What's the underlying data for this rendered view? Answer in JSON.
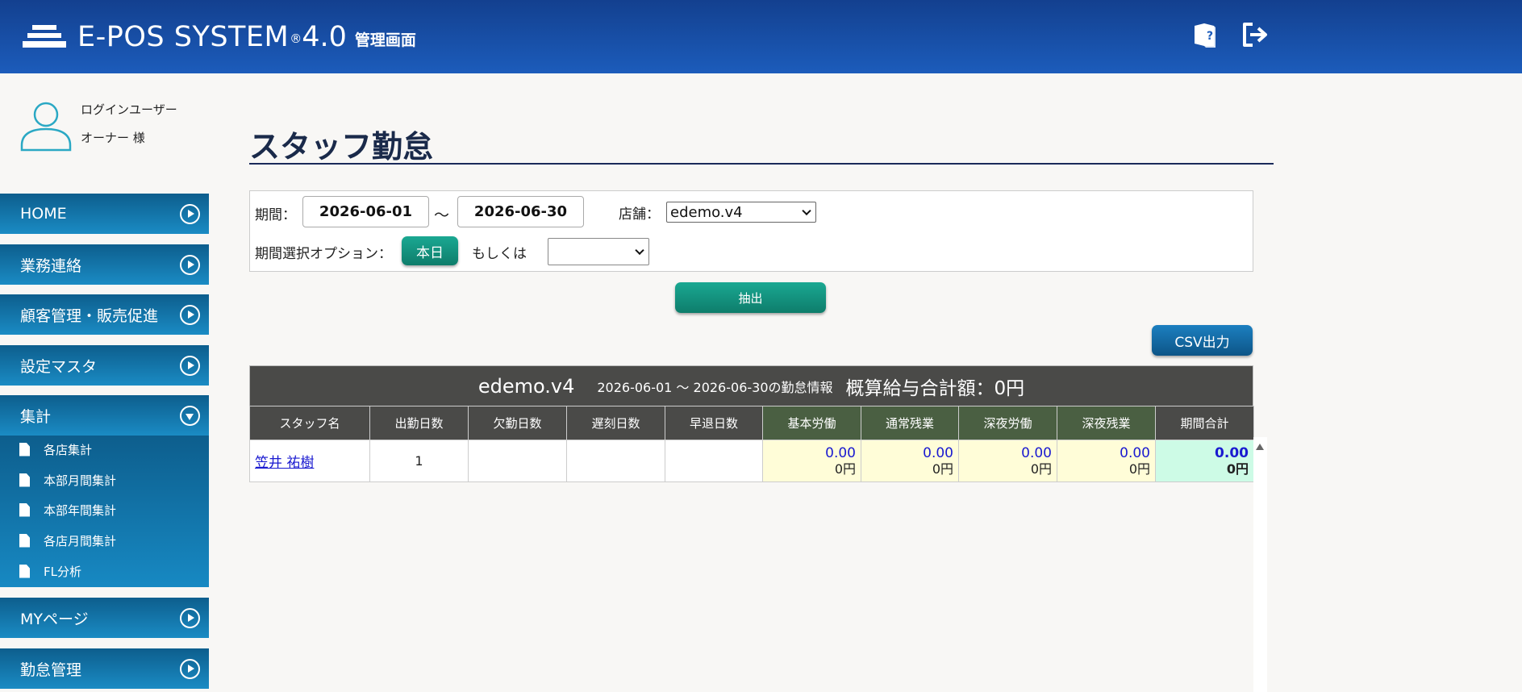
{
  "header": {
    "logo_text": "E-POS SYSTEM",
    "logo_reg": "®",
    "logo_version": "4.0",
    "logo_subtitle": "管理画面",
    "icons": [
      "help-book-icon",
      "logout-icon"
    ]
  },
  "user": {
    "label": "ログインユーザー",
    "name": "オーナー 様",
    "icon": "user-icon"
  },
  "sidebar": {
    "items": [
      {
        "label": "HOME"
      },
      {
        "label": "業務連絡"
      },
      {
        "label": "顧客管理・販売促進"
      },
      {
        "label": "設定マスタ"
      },
      {
        "label": "集計"
      },
      {
        "label": "MYページ"
      },
      {
        "label": "勤怠管理"
      }
    ],
    "submenu": [
      {
        "label": "各店集計"
      },
      {
        "label": "本部月間集計"
      },
      {
        "label": "本部年間集計"
      },
      {
        "label": "各店月間集計"
      },
      {
        "label": "FL分析"
      }
    ]
  },
  "page": {
    "title": "スタッフ勤怠"
  },
  "filter": {
    "period_label": "期間：",
    "date_from": "2026-06-01",
    "tilde": "～",
    "date_to": "2026-06-30",
    "store_label": "店舗：",
    "store_value": "edemo.v4",
    "option_label": "期間選択オプション：",
    "today_button": "本日",
    "or_label": "もしくは",
    "option_select_value": "",
    "extract_button": "抽出"
  },
  "csv_button": "CSV出力",
  "table": {
    "store_name": "edemo.v4",
    "period_text": "2026-06-01 ～ 2026-06-30の勤怠情報",
    "total_text": "概算給与合計額：0円",
    "columns": [
      "スタッフ名",
      "出勤日数",
      "欠勤日数",
      "遅刻日数",
      "早退日数",
      "基本労働",
      "通常残業",
      "深夜労働",
      "深夜残業",
      "期間合計"
    ],
    "rows": [
      {
        "staff": "笠井 祐樹",
        "attend_days": "1",
        "absent_days": "",
        "late_days": "",
        "early_days": "",
        "basic": {
          "hours": "0.00",
          "yen": "0円"
        },
        "overtime": {
          "hours": "0.00",
          "yen": "0円"
        },
        "night": {
          "hours": "0.00",
          "yen": "0円"
        },
        "night_overtime": {
          "hours": "0.00",
          "yen": "0円"
        },
        "total": {
          "hours": "0.00",
          "yen": "0円"
        }
      }
    ]
  },
  "colors": {
    "header_bg": "#1c5cbb",
    "nav_bg": "#1a8bc4",
    "green_button": "#0e7d6b",
    "blue_button": "#0d5587"
  }
}
